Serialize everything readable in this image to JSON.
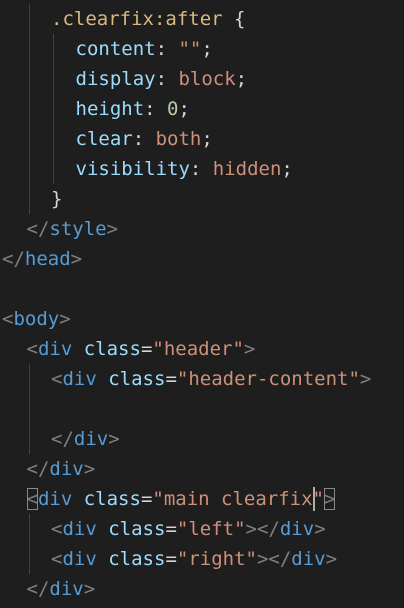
{
  "editor": {
    "language": "html",
    "colors": {
      "background": "#1e1e1e",
      "tag": "#569cd6",
      "attribute": "#9cdcfe",
      "string": "#ce9178",
      "selector": "#d7ba7d",
      "number": "#b5cea8",
      "punctuation": "#808080"
    },
    "lines": [
      {
        "indent": 2,
        "tokens": [
          {
            "t": ".clearfix:after",
            "c": "sel"
          },
          {
            "t": " {",
            "c": "plain"
          }
        ]
      },
      {
        "indent": 3,
        "tokens": [
          {
            "t": "content",
            "c": "prop"
          },
          {
            "t": ": ",
            "c": "plain"
          },
          {
            "t": "\"\"",
            "c": "val"
          },
          {
            "t": ";",
            "c": "plain"
          }
        ]
      },
      {
        "indent": 3,
        "tokens": [
          {
            "t": "display",
            "c": "prop"
          },
          {
            "t": ": ",
            "c": "plain"
          },
          {
            "t": "block",
            "c": "val"
          },
          {
            "t": ";",
            "c": "plain"
          }
        ]
      },
      {
        "indent": 3,
        "tokens": [
          {
            "t": "height",
            "c": "prop"
          },
          {
            "t": ": ",
            "c": "plain"
          },
          {
            "t": "0",
            "c": "num"
          },
          {
            "t": ";",
            "c": "plain"
          }
        ]
      },
      {
        "indent": 3,
        "tokens": [
          {
            "t": "clear",
            "c": "prop"
          },
          {
            "t": ": ",
            "c": "plain"
          },
          {
            "t": "both",
            "c": "val"
          },
          {
            "t": ";",
            "c": "plain"
          }
        ]
      },
      {
        "indent": 3,
        "tokens": [
          {
            "t": "visibility",
            "c": "prop"
          },
          {
            "t": ": ",
            "c": "plain"
          },
          {
            "t": "hidden",
            "c": "val"
          },
          {
            "t": ";",
            "c": "plain"
          }
        ]
      },
      {
        "indent": 2,
        "tokens": [
          {
            "t": "}",
            "c": "plain"
          }
        ]
      },
      {
        "indent": 1,
        "tokens": [
          {
            "t": "</",
            "c": "punct"
          },
          {
            "t": "style",
            "c": "tag"
          },
          {
            "t": ">",
            "c": "punct"
          }
        ]
      },
      {
        "indent": 0,
        "tokens": [
          {
            "t": "</",
            "c": "punct"
          },
          {
            "t": "head",
            "c": "tag"
          },
          {
            "t": ">",
            "c": "punct"
          }
        ]
      },
      {
        "indent": 0,
        "tokens": []
      },
      {
        "indent": 0,
        "tokens": [
          {
            "t": "<",
            "c": "punct"
          },
          {
            "t": "body",
            "c": "tag"
          },
          {
            "t": ">",
            "c": "punct"
          }
        ]
      },
      {
        "indent": 1,
        "tokens": [
          {
            "t": "<",
            "c": "punct"
          },
          {
            "t": "div",
            "c": "tag"
          },
          {
            "t": " ",
            "c": "plain"
          },
          {
            "t": "class",
            "c": "attr"
          },
          {
            "t": "=",
            "c": "eq"
          },
          {
            "t": "\"header\"",
            "c": "str"
          },
          {
            "t": ">",
            "c": "punct"
          }
        ]
      },
      {
        "indent": 2,
        "tokens": [
          {
            "t": "<",
            "c": "punct"
          },
          {
            "t": "div",
            "c": "tag"
          },
          {
            "t": " ",
            "c": "plain"
          },
          {
            "t": "class",
            "c": "attr"
          },
          {
            "t": "=",
            "c": "eq"
          },
          {
            "t": "\"header-content\"",
            "c": "str"
          },
          {
            "t": ">",
            "c": "punct"
          }
        ]
      },
      {
        "indent": 0,
        "tokens": []
      },
      {
        "indent": 2,
        "tokens": [
          {
            "t": "</",
            "c": "punct"
          },
          {
            "t": "div",
            "c": "tag"
          },
          {
            "t": ">",
            "c": "punct"
          }
        ]
      },
      {
        "indent": 1,
        "tokens": [
          {
            "t": "</",
            "c": "punct"
          },
          {
            "t": "div",
            "c": "tag"
          },
          {
            "t": ">",
            "c": "punct"
          }
        ]
      },
      {
        "indent": 1,
        "tokens": [
          {
            "t": "<",
            "c": "punct",
            "m": 1
          },
          {
            "t": "div",
            "c": "tag"
          },
          {
            "t": " ",
            "c": "plain"
          },
          {
            "t": "class",
            "c": "attr"
          },
          {
            "t": "=",
            "c": "eq"
          },
          {
            "t": "\"main clearfix\"",
            "c": "str",
            "cursor": 14
          },
          {
            "t": ">",
            "c": "punct",
            "m": 1
          }
        ]
      },
      {
        "indent": 2,
        "tokens": [
          {
            "t": "<",
            "c": "punct"
          },
          {
            "t": "div",
            "c": "tag"
          },
          {
            "t": " ",
            "c": "plain"
          },
          {
            "t": "class",
            "c": "attr"
          },
          {
            "t": "=",
            "c": "eq"
          },
          {
            "t": "\"left\"",
            "c": "str"
          },
          {
            "t": "></",
            "c": "punct"
          },
          {
            "t": "div",
            "c": "tag"
          },
          {
            "t": ">",
            "c": "punct"
          }
        ]
      },
      {
        "indent": 2,
        "tokens": [
          {
            "t": "<",
            "c": "punct"
          },
          {
            "t": "div",
            "c": "tag"
          },
          {
            "t": " ",
            "c": "plain"
          },
          {
            "t": "class",
            "c": "attr"
          },
          {
            "t": "=",
            "c": "eq"
          },
          {
            "t": "\"right\"",
            "c": "str"
          },
          {
            "t": "></",
            "c": "punct"
          },
          {
            "t": "div",
            "c": "tag"
          },
          {
            "t": ">",
            "c": "punct"
          }
        ]
      },
      {
        "indent": 1,
        "tokens": [
          {
            "t": "</",
            "c": "punct"
          },
          {
            "t": "div",
            "c": "tag"
          },
          {
            "t": ">",
            "c": "punct"
          }
        ]
      }
    ]
  }
}
